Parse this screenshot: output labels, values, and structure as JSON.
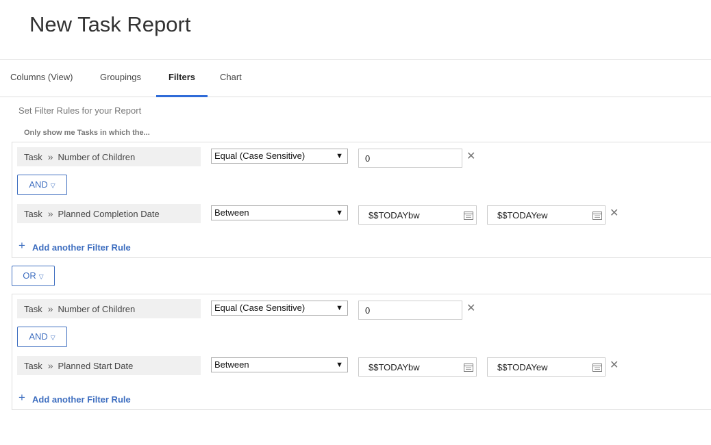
{
  "page": {
    "title": "New Task Report"
  },
  "tabs": [
    {
      "label": "Columns (View)"
    },
    {
      "label": "Groupings"
    },
    {
      "label": "Filters",
      "active": true
    },
    {
      "label": "Chart"
    }
  ],
  "filters": {
    "subtitle": "Set Filter Rules for your Report",
    "hint": "Only show me Tasks in which the...",
    "between_groups": "OR",
    "groups": [
      {
        "rules": [
          {
            "object": "Task",
            "field": "Number of Children",
            "operator": "Equal (Case Sensitive)",
            "values": [
              "0"
            ]
          },
          {
            "object": "Task",
            "field": "Planned Completion Date",
            "operator": "Between",
            "values": [
              "$$TODAYbw",
              "$$TODAYew"
            ]
          }
        ],
        "conjunction": "AND",
        "add_label": "Add another Filter Rule"
      },
      {
        "rules": [
          {
            "object": "Task",
            "field": "Number of Children",
            "operator": "Equal (Case Sensitive)",
            "values": [
              "0"
            ]
          },
          {
            "object": "Task",
            "field": "Planned Start Date",
            "operator": "Between",
            "values": [
              "$$TODAYbw",
              "$$TODAYew"
            ]
          }
        ],
        "conjunction": "AND",
        "add_label": "Add another Filter Rule"
      }
    ]
  },
  "icons": {
    "remove": "close-icon",
    "date": "calendar-icon",
    "separator": "double-chevron-right-icon",
    "dropdown": "chevron-down-icon",
    "add": "plus-icon"
  },
  "colors": {
    "accent": "#2f6bd8",
    "link": "#3f6fc0",
    "field_bg": "#f0f0f0"
  }
}
